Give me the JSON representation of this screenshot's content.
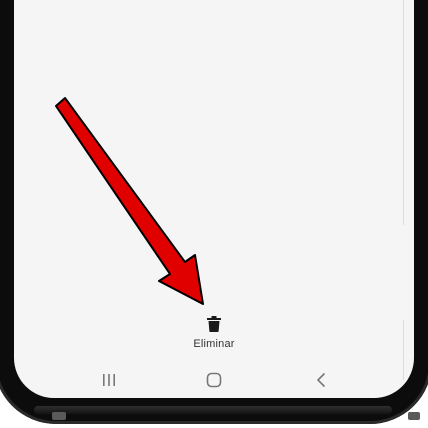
{
  "action_bar": {
    "delete_label": "Eliminar",
    "delete_icon": "trash-icon"
  },
  "nav_bar": {
    "recents_icon": "recents-icon",
    "home_icon": "home-icon",
    "back_icon": "back-icon"
  },
  "annotation": {
    "arrow_color": "#e10000",
    "arrow_outline": "#000000",
    "points_to": "delete-button"
  },
  "colors": {
    "screen_background": "#f5f5f5",
    "phone_frame": "#0c0c0c",
    "nav_icon": "#777777",
    "label_text": "#333333"
  }
}
